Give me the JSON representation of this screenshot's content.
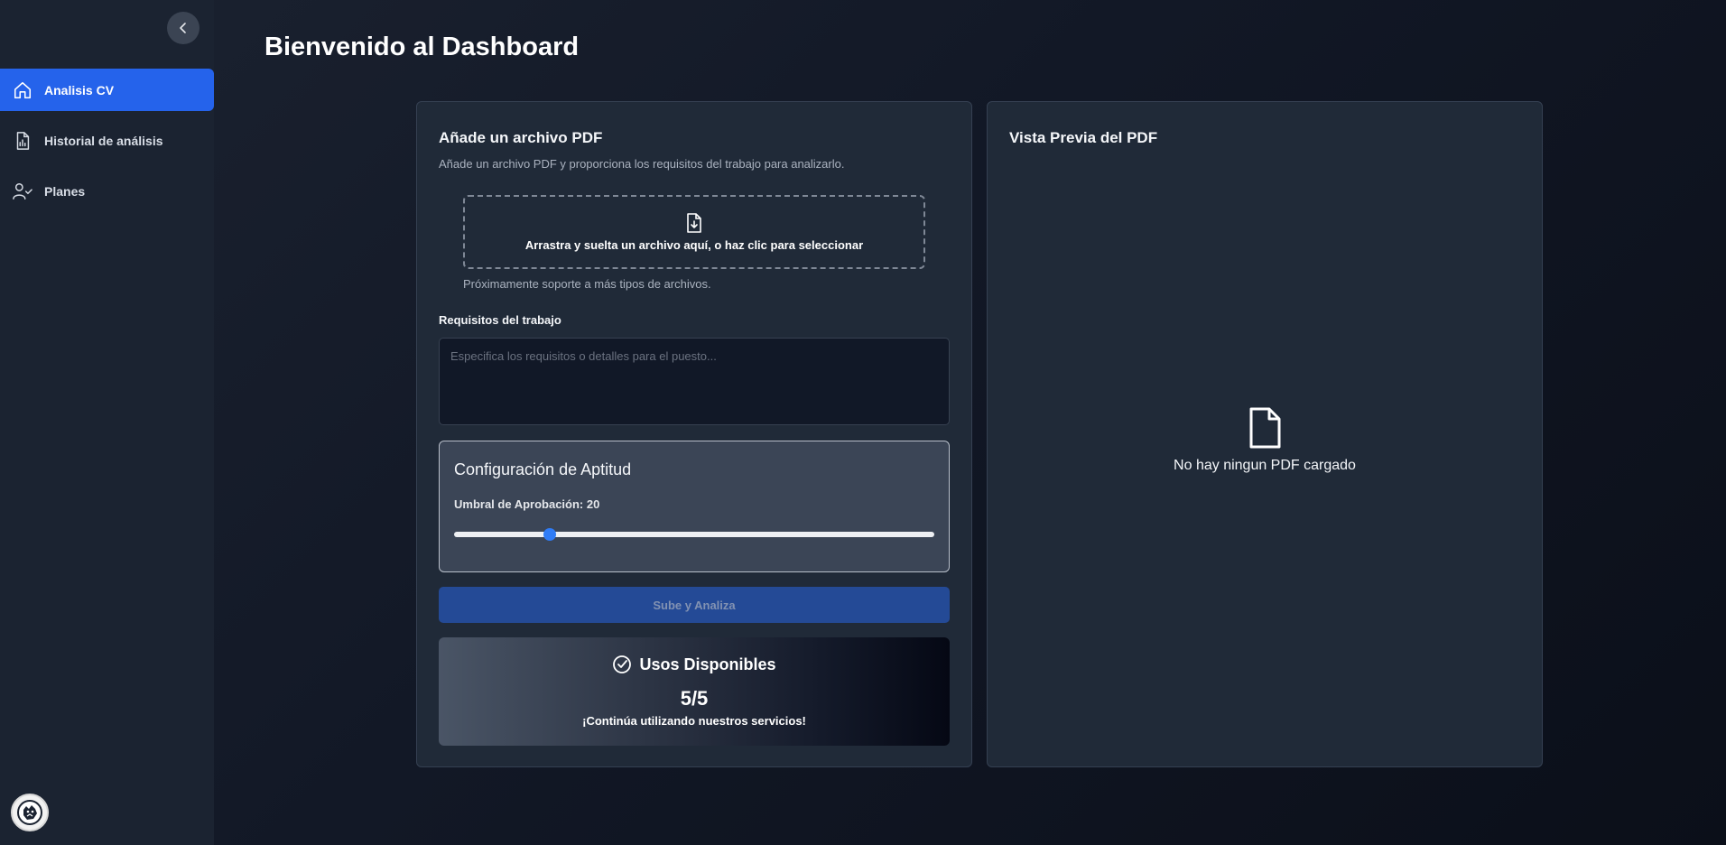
{
  "header": {
    "title": "Bienvenido al Dashboard"
  },
  "sidebar": {
    "items": [
      {
        "label": "Analisis CV",
        "icon": "home-icon",
        "active": true
      },
      {
        "label": "Historial de análisis",
        "icon": "report-icon",
        "active": false
      },
      {
        "label": "Planes",
        "icon": "user-check-icon",
        "active": false
      }
    ]
  },
  "upload": {
    "title": "Añade un archivo PDF",
    "subtitle": "Añade un archivo PDF y proporciona los requisitos del trabajo para analizarlo.",
    "dropzone_text": "Arrastra y suelta un archivo aquí, o haz clic para seleccionar",
    "note": "Próximamente soporte a más tipos de archivos.",
    "requirements_label": "Requisitos del trabajo",
    "requirements_placeholder": "Especifica los requisitos o detalles para el puesto...",
    "requirements_value": ""
  },
  "aptitude": {
    "title": "Configuración de Aptitud",
    "threshold_label": "Umbral de Aprobación: 20",
    "threshold_value": 20,
    "threshold_min": 0,
    "threshold_max": 100
  },
  "submit": {
    "label": "Sube y Analiza"
  },
  "usage": {
    "title": "Usos Disponibles",
    "count": "5/5",
    "message": "¡Continúa utilizando nuestros servicios!"
  },
  "preview": {
    "title": "Vista Previa del PDF",
    "empty_text": "No hay ningun PDF cargado"
  },
  "colors": {
    "accent": "#2563eb",
    "slider_thumb": "#2f7cf6",
    "card": "#202a38"
  }
}
